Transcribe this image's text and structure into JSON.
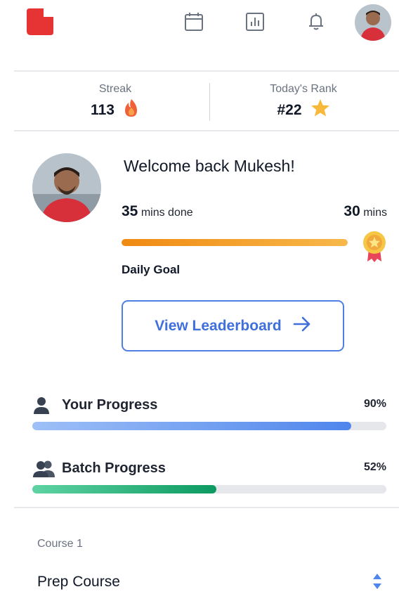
{
  "header": {
    "logo_icon": "brand-logo-icon",
    "icons": [
      "calendar-icon",
      "bar-chart-icon",
      "bell-icon"
    ],
    "avatar_icon": "user-avatar"
  },
  "stats": {
    "streak": {
      "label": "Streak",
      "value": "113",
      "icon": "flame-icon"
    },
    "rank": {
      "label": "Today's Rank",
      "value": "#22",
      "icon": "star-icon"
    }
  },
  "welcome": {
    "title": "Welcome back Mukesh!",
    "done_value": "35",
    "done_unit": "mins done",
    "goal_value": "30",
    "goal_unit": "mins",
    "goal_label": "Daily Goal",
    "goal_fill_fraction": 1.0,
    "medal_icon": "medal-icon"
  },
  "leaderboard_button": {
    "label": "View Leaderboard",
    "icon": "arrow-right-icon"
  },
  "progress": [
    {
      "label": "Your Progress",
      "percent_label": "90%",
      "fill_percent": 90,
      "icon": "person-icon"
    },
    {
      "label": "Batch Progress",
      "percent_label": "52%",
      "fill_percent": 52,
      "icon": "group-icon"
    }
  ],
  "course": {
    "caption": "Course 1",
    "selected": "Prep Course",
    "icon": "select-arrows-icon"
  },
  "colors": {
    "brand_red": "#e63434",
    "accent_blue": "#3f6fda",
    "goal_orange": "#f08a12",
    "batch_green": "#0c9a61",
    "star_gold": "#f6b93b"
  }
}
